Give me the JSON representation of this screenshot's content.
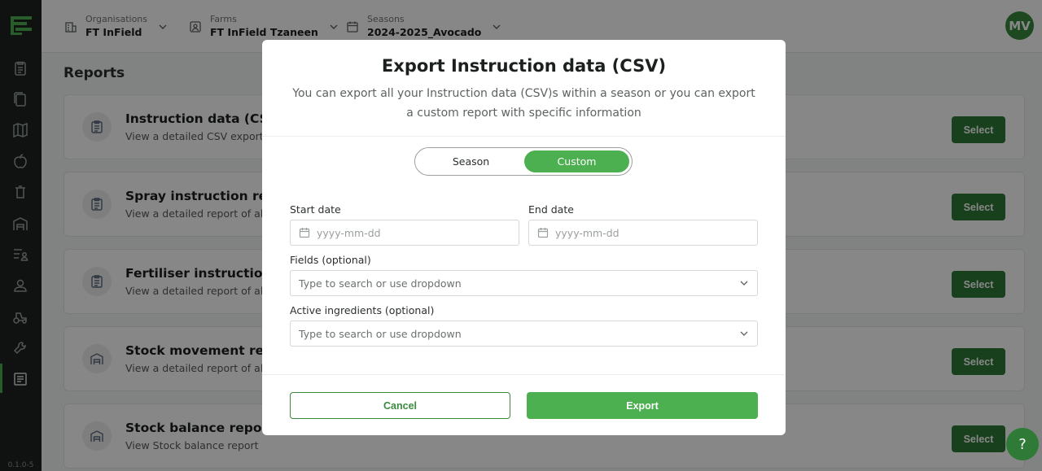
{
  "sidebar": {
    "icons": [
      "clipboard-icon",
      "copy-icon",
      "map-icon",
      "apple-icon",
      "trash-icon",
      "warehouse-icon",
      "list-user-icon",
      "user-icon",
      "tractor-icon",
      "tools-icon",
      "report-icon"
    ],
    "version": "0.1.0-5"
  },
  "topbar": {
    "organisation": {
      "label": "Organisations",
      "value": "FT InField"
    },
    "farm": {
      "label": "Farms",
      "value": "FT InField Tzaneen"
    },
    "season": {
      "label": "Seasons",
      "value": "2024-2025_Avocado"
    },
    "avatar": "MV"
  },
  "page": {
    "title": "Reports",
    "reports": [
      {
        "title": "Instruction data (CSV",
        "description": "View a detailed CSV export o",
        "select_label": "Select",
        "icon": "clipboard-icon"
      },
      {
        "title": "Spray instruction repo",
        "description": "View a detailed report of all y",
        "select_label": "Select",
        "icon": "clipboard-icon"
      },
      {
        "title": "Fertiliser instruction re",
        "description": "View a detailed report of all y",
        "select_label": "Select",
        "icon": "clipboard-icon"
      },
      {
        "title": "Stock movement repo",
        "description": "View a detailed report of all y",
        "select_label": "Select",
        "icon": "warehouse-icon"
      },
      {
        "title": "Stock balance report",
        "description": "View Stock balance report",
        "select_label": "Select",
        "icon": "warehouse-icon"
      }
    ],
    "help_label": "?"
  },
  "modal": {
    "title": "Export Instruction data (CSV)",
    "subtitle": "You can export all your Instruction data (CSV)s within a season or you can export a custom report with specific information",
    "toggle": {
      "season_label": "Season",
      "custom_label": "Custom",
      "selected": "Custom"
    },
    "start_date": {
      "label": "Start date",
      "placeholder": "yyyy-mm-dd"
    },
    "end_date": {
      "label": "End date",
      "placeholder": "yyyy-mm-dd"
    },
    "fields": {
      "label": "Fields (optional)",
      "placeholder": "Type to search or use dropdown"
    },
    "active_ingredients": {
      "label": "Active ingredients (optional)",
      "placeholder": "Type to search or use dropdown"
    },
    "cancel_label": "Cancel",
    "export_label": "Export"
  },
  "colors": {
    "primary": "#4caf50",
    "primary_dark": "#2f7a36",
    "sidebar_bg": "#1d2320"
  }
}
